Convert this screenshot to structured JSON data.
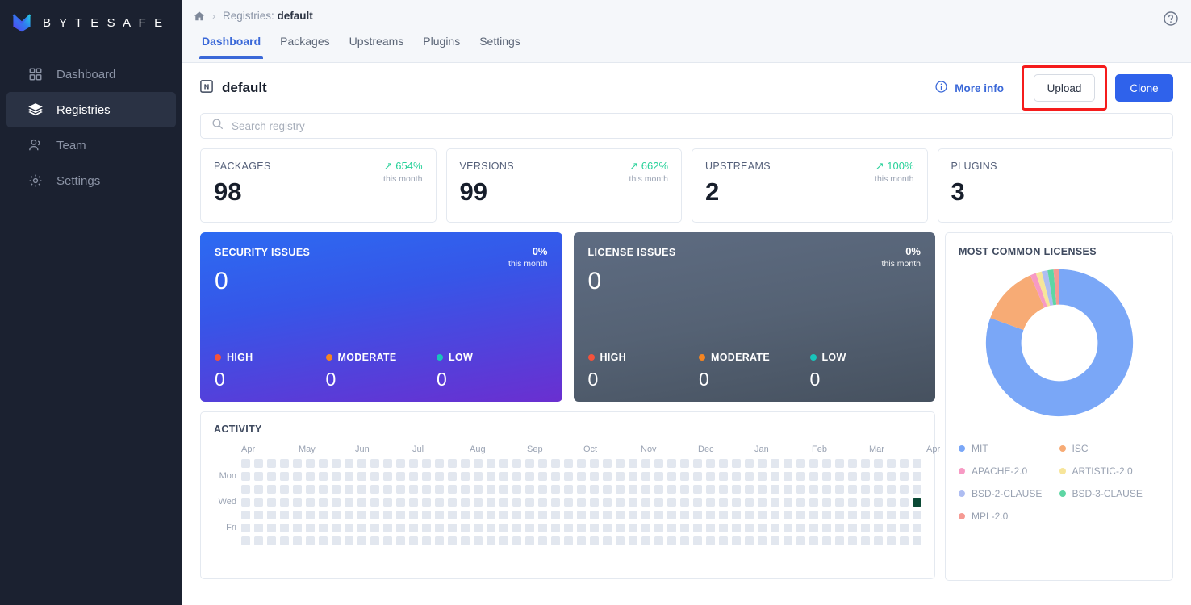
{
  "sidebar": {
    "brand": "B Y T E S A F E",
    "items": [
      {
        "label": "Dashboard",
        "icon": "grid-icon",
        "active": false
      },
      {
        "label": "Registries",
        "icon": "layers-icon",
        "active": true
      },
      {
        "label": "Team",
        "icon": "users-icon",
        "active": false
      },
      {
        "label": "Settings",
        "icon": "gear-icon",
        "active": false
      }
    ]
  },
  "topbar": {
    "breadcrumb_home_icon": "home-icon",
    "breadcrumb_separator": "›",
    "breadcrumb_prefix": "Registries: ",
    "breadcrumb_current": "default",
    "help_icon": "question-circle-icon",
    "tabs": [
      {
        "label": "Dashboard",
        "active": true
      },
      {
        "label": "Packages",
        "active": false
      },
      {
        "label": "Upstreams",
        "active": false
      },
      {
        "label": "Plugins",
        "active": false
      },
      {
        "label": "Settings",
        "active": false
      }
    ]
  },
  "page": {
    "title": "default",
    "title_icon": "registry-icon",
    "more_info_label": "More info",
    "more_info_icon": "info-circle-icon",
    "upload_label": "Upload",
    "clone_label": "Clone",
    "upload_highlight_color": "#f51c1c",
    "clone_color": "#2f62eb",
    "accent_color": "#3a68d8"
  },
  "search": {
    "placeholder": "Search registry",
    "value": "",
    "icon": "search-icon"
  },
  "stats": [
    {
      "label": "PACKAGES",
      "value": "98",
      "trend": "654%",
      "trend_sub": "this month",
      "trend_icon": "arrow-up-right-icon",
      "trend_color": "#2ad19a"
    },
    {
      "label": "VERSIONS",
      "value": "99",
      "trend": "662%",
      "trend_sub": "this month",
      "trend_icon": "arrow-up-right-icon",
      "trend_color": "#2ad19a"
    },
    {
      "label": "UPSTREAMS",
      "value": "2",
      "trend": "100%",
      "trend_sub": "this month",
      "trend_icon": "arrow-up-right-icon",
      "trend_color": "#2ad19a"
    },
    {
      "label": "PLUGINS",
      "value": "3",
      "trend": "",
      "trend_sub": "",
      "trend_icon": "",
      "trend_color": ""
    }
  ],
  "issue_cards": [
    {
      "title": "SECURITY ISSUES",
      "value": "0",
      "trend": "0%",
      "trend_sub": "this month",
      "breakdown": [
        {
          "label": "HIGH",
          "value": "0",
          "color": "#f4523b"
        },
        {
          "label": "MODERATE",
          "value": "0",
          "color": "#f58521"
        },
        {
          "label": "LOW",
          "value": "0",
          "color": "#18c4bb"
        }
      ]
    },
    {
      "title": "LICENSE ISSUES",
      "value": "0",
      "trend": "0%",
      "trend_sub": "this month",
      "breakdown": [
        {
          "label": "HIGH",
          "value": "0",
          "color": "#f4523b"
        },
        {
          "label": "MODERATE",
          "value": "0",
          "color": "#f58521"
        },
        {
          "label": "LOW",
          "value": "0",
          "color": "#18c4bb"
        }
      ]
    }
  ],
  "activity": {
    "title": "ACTIVITY",
    "day_labels": [
      "",
      "Mon",
      "",
      "Wed",
      "",
      "Fri",
      ""
    ],
    "month_labels": [
      "Apr",
      "May",
      "Jun",
      "Jul",
      "Aug",
      "Sep",
      "Oct",
      "Nov",
      "Dec",
      "Jan",
      "Feb",
      "Mar",
      "Apr"
    ],
    "weeks": 53,
    "rows": 7,
    "empty_color": "#e2e7ef",
    "active_color": "#0b4935",
    "active_cells": [
      {
        "week": 52,
        "day": 3
      }
    ]
  },
  "licenses": {
    "title": "MOST COMMON LICENSES",
    "chart_data": {
      "type": "pie",
      "title": "MOST COMMON LICENSES",
      "labels": [
        "MIT",
        "ISC",
        "APACHE-2.0",
        "ARTISTIC-2.0",
        "BSD-2-CLAUSE",
        "BSD-3-CLAUSE",
        "MPL-2.0"
      ],
      "values": [
        80.5,
        13.0,
        1.3,
        1.3,
        1.3,
        1.3,
        1.3
      ],
      "colors": [
        "#7aa7f7",
        "#f7ab75",
        "#f79ac4",
        "#f7e59a",
        "#aebdf2",
        "#5ed6a4",
        "#f59a93"
      ],
      "legend_position": "bottom",
      "inner_radius_ratio": 0.52
    },
    "legend": [
      {
        "label": "MIT",
        "color": "#7aa7f7"
      },
      {
        "label": "ISC",
        "color": "#f7ab75"
      },
      {
        "label": "APACHE-2.0",
        "color": "#f79ac4"
      },
      {
        "label": "ARTISTIC-2.0",
        "color": "#f7e59a"
      },
      {
        "label": "BSD-2-CLAUSE",
        "color": "#aebdf2"
      },
      {
        "label": "BSD-3-CLAUSE",
        "color": "#5ed6a4"
      },
      {
        "label": "MPL-2.0",
        "color": "#f59a93"
      }
    ]
  }
}
